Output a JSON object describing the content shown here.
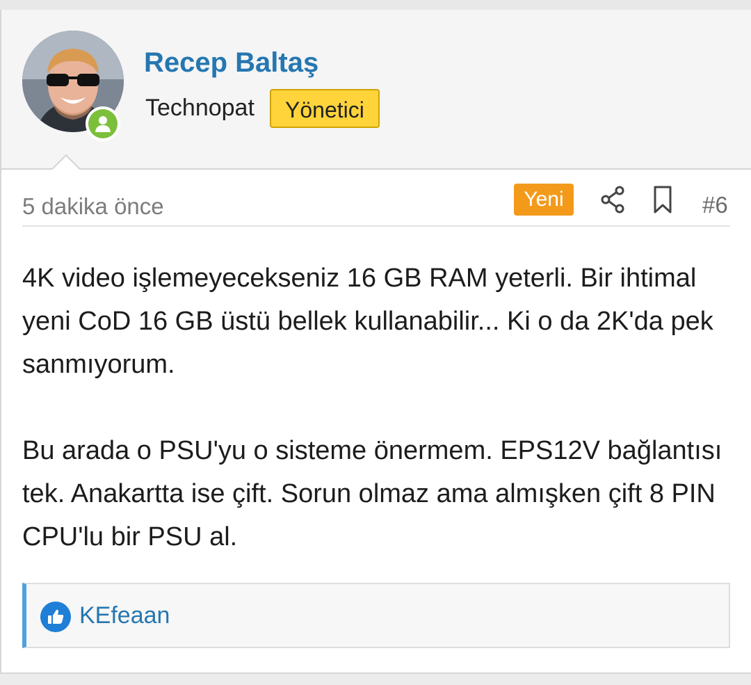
{
  "author": {
    "name": "Recep Baltaş",
    "title": "Technopat",
    "role_badge": "Yönetici",
    "avatar_icon": "user-avatar-photo",
    "online_icon": "online-status-icon"
  },
  "meta": {
    "time": "5 dakika önce",
    "new_badge": "Yeni",
    "share_icon": "share-icon",
    "bookmark_icon": "bookmark-icon",
    "post_number": "#6"
  },
  "message": {
    "paragraphs": [
      "4K video işlemeyecekseniz 16 GB RAM yeterli. Bir ihtimal yeni CoD 16 GB üstü bellek kullanabilir... Ki o da 2K'da pek sanmıyorum.",
      "Bu arada o PSU'yu o sisteme önermem. EPS12V bağlantısı tek. Anakartta ise çift. Sorun olmaz ama almışken çift 8 PIN CPU'lu bir PSU al."
    ]
  },
  "reactions": {
    "icon": "like-icon",
    "users": "KEfeaan"
  },
  "colors": {
    "username": "#2577b1",
    "role_badge": "#ffd43b",
    "new_badge": "#f39a1b",
    "online": "#7cbf3b",
    "reaction_accent": "#4ea1df"
  }
}
